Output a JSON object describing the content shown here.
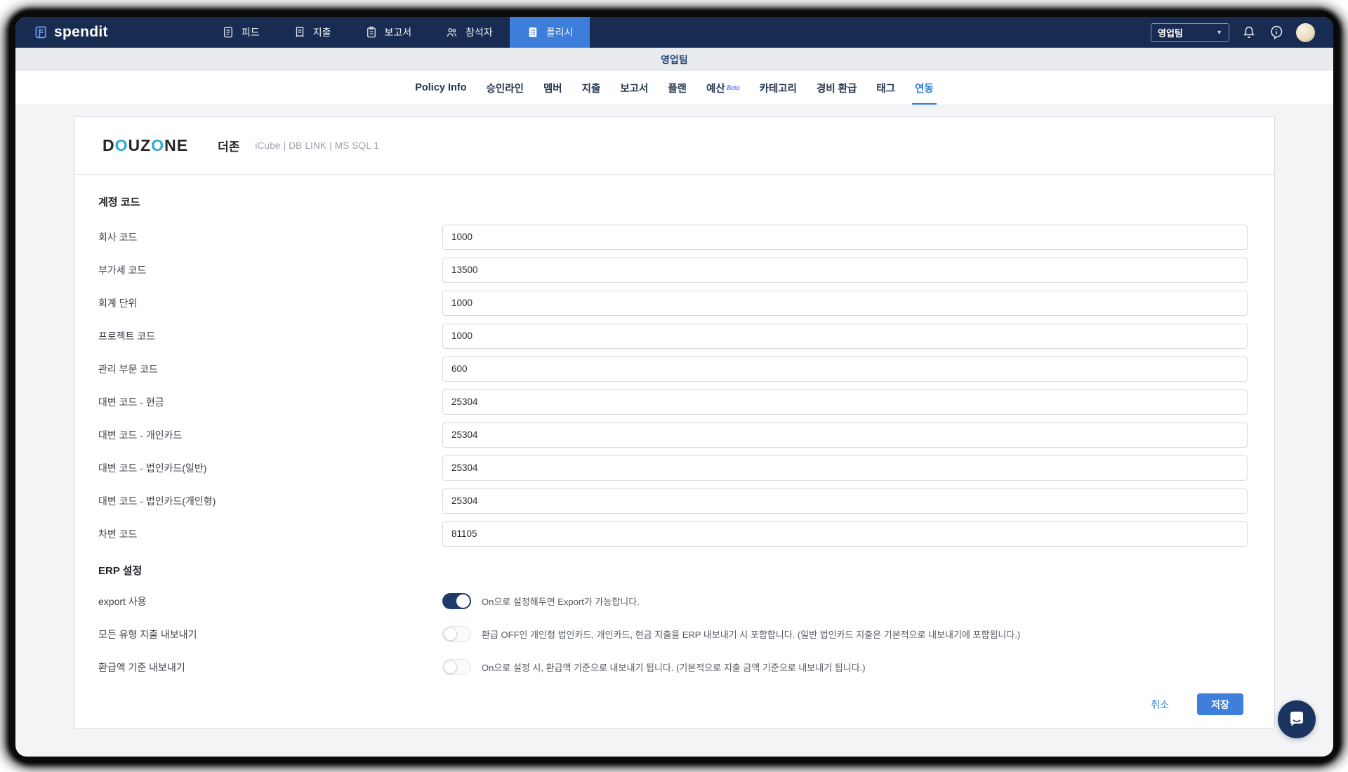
{
  "navbar": {
    "brand": "spendit",
    "items": [
      {
        "label": "피드",
        "icon": "feed-icon",
        "active": false
      },
      {
        "label": "지출",
        "icon": "expense-icon",
        "active": false
      },
      {
        "label": "보고서",
        "icon": "report-icon",
        "active": false
      },
      {
        "label": "참석자",
        "icon": "attendees-icon",
        "active": false
      },
      {
        "label": "폴리시",
        "icon": "policy-icon",
        "active": true
      }
    ],
    "team_selector": {
      "value": "영업팀"
    },
    "right_icons": [
      "notification-bell-icon",
      "help-icon",
      "avatar"
    ]
  },
  "team_header": {
    "title": "영업팀"
  },
  "tabs": {
    "items": [
      {
        "label": "Policy Info",
        "active": false
      },
      {
        "label": "승인라인",
        "active": false
      },
      {
        "label": "멤버",
        "active": false
      },
      {
        "label": "지출",
        "active": false
      },
      {
        "label": "보고서",
        "active": false
      },
      {
        "label": "플랜",
        "active": false
      },
      {
        "label": "예산",
        "badge": "Beta",
        "active": false
      },
      {
        "label": "카테고리",
        "active": false
      },
      {
        "label": "경비 환급",
        "active": false
      },
      {
        "label": "태그",
        "active": false
      },
      {
        "label": "연동",
        "active": true
      }
    ]
  },
  "integration": {
    "logo_chars": [
      "D",
      "O",
      "U",
      "Z",
      "O",
      "N",
      "E"
    ],
    "name": "더존",
    "subtitle": "iCube | DB LINK | MS SQL 1"
  },
  "account_codes": {
    "heading": "계정 코드",
    "fields": [
      {
        "label": "회사 코드",
        "value": "1000"
      },
      {
        "label": "부가세 코드",
        "value": "13500"
      },
      {
        "label": "회계 단위",
        "value": "1000"
      },
      {
        "label": "프로젝트 코드",
        "value": "1000"
      },
      {
        "label": "관리 부문 코드",
        "value": "600"
      },
      {
        "label": "대변 코드 - 현금",
        "value": "25304"
      },
      {
        "label": "대변 코드 - 개인카드",
        "value": "25304"
      },
      {
        "label": "대변 코드 - 법인카드(일반)",
        "value": "25304"
      },
      {
        "label": "대변 코드 - 법인카드(개인형)",
        "value": "25304"
      },
      {
        "label": "차변 코드",
        "value": "81105"
      }
    ]
  },
  "erp_settings": {
    "heading": "ERP 설정",
    "toggles": [
      {
        "label": "export 사용",
        "on": true,
        "description": "On으로 설정해두면 Export가 가능합니다."
      },
      {
        "label": "모든 유형 지출 내보내기",
        "on": false,
        "description": "환급 OFF인 개인형 법인카드, 개인카드, 현금 지출을 ERP 내보내기 시 포함합니다. (일반 법인카드 지출은 기본적으로 내보내기에 포함됩니다.)"
      },
      {
        "label": "환급액 기준 내보내기",
        "on": false,
        "description": "On으로 설정 시, 환급액 기준으로 내보내기 됩니다. (기본적으로 지출 금액 기준으로 내보내기 됩니다.)"
      }
    ]
  },
  "actions": {
    "cancel": "취소",
    "save": "저장"
  },
  "colors": {
    "navbar": "#182c52",
    "accent": "#3d7edb",
    "active_tab": "#2e7ce1",
    "toggle_on": "#1d3a69",
    "douzone_blue": "#29a9e1",
    "save_button": "#3d7fdb"
  }
}
